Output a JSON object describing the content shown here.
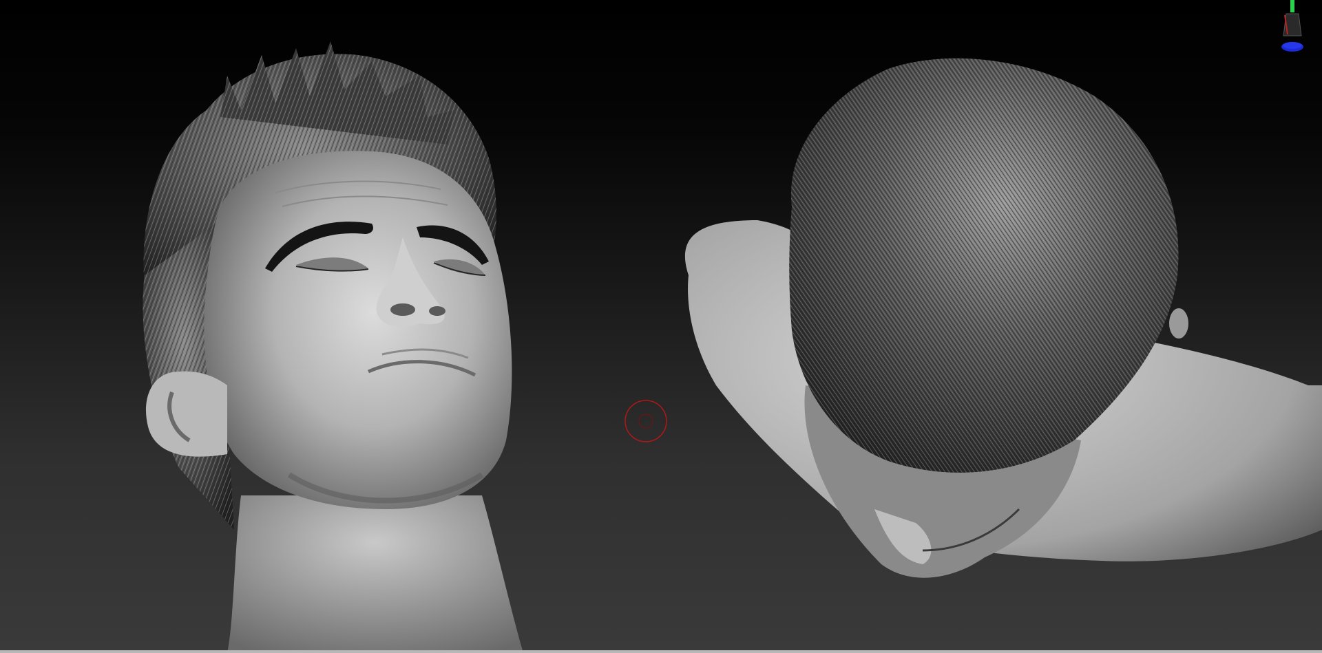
{
  "app": {
    "view": "3d-viewport",
    "background_top": "#000000",
    "background_bottom": "#3a3a3a"
  },
  "viewport": {
    "models": [
      {
        "id": "head-front",
        "description_icon": "sculpted-head-upward-view"
      },
      {
        "id": "head-top",
        "description_icon": "sculpted-head-top-view"
      }
    ],
    "brush": {
      "icon": "brush-cursor-icon",
      "color": "#b01818"
    },
    "gizmo": {
      "icon": "axis-gizmo-icon",
      "y_color": "#2bd14a",
      "z_color": "#1a2ad8",
      "x_color": "#c02020"
    }
  }
}
